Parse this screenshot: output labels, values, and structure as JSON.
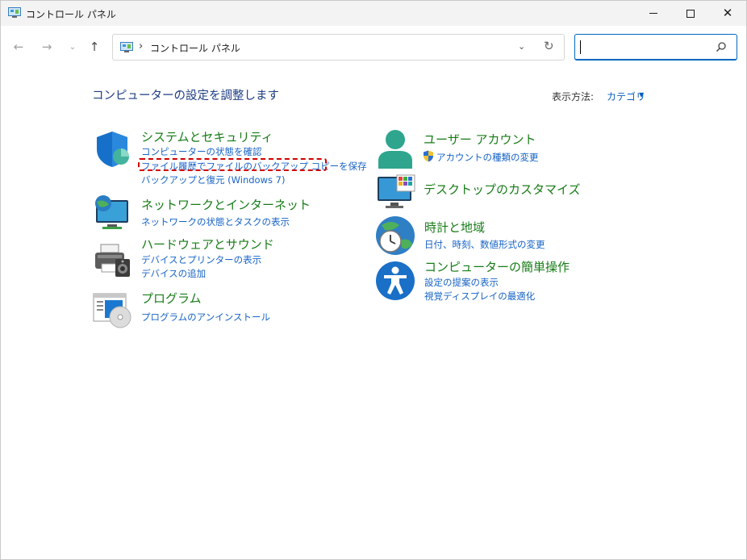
{
  "window": {
    "title": "コントロール パネル"
  },
  "nav": {
    "back_glyph": "←",
    "forward_glyph": "→",
    "recent_glyph": "⌄",
    "up_glyph": "↑"
  },
  "address_bar": {
    "separator": "›",
    "path": "コントロール パネル",
    "dropdown_glyph": "⌄",
    "refresh_glyph": "↻"
  },
  "search": {
    "value": ""
  },
  "header": {
    "title": "コンピューターの設定を調整します",
    "view_by_label": "表示方法:",
    "view_by_value": "カテゴリ",
    "view_by_arrow": "▼"
  },
  "categories": [
    {
      "title": "システムとセキュリティ",
      "links": [
        "コンピューターの状態を確認",
        "ファイル履歴でファイルのバックアップ コピーを保存",
        "バックアップと復元 (Windows 7)"
      ]
    },
    {
      "title": "ネットワークとインターネット",
      "links": [
        "ネットワークの状態とタスクの表示"
      ]
    },
    {
      "title": "ハードウェアとサウンド",
      "links": [
        "デバイスとプリンターの表示",
        "デバイスの追加"
      ]
    },
    {
      "title": "プログラム",
      "links": [
        "プログラムのアンインストール"
      ]
    },
    {
      "title": "ユーザー アカウント",
      "links": [
        "アカウントの種類の変更"
      ]
    },
    {
      "title": "デスクトップのカスタマイズ",
      "links": []
    },
    {
      "title": "時計と地域",
      "links": [
        "日付、時刻、数値形式の変更"
      ]
    },
    {
      "title": "コンピューターの簡単操作",
      "links": [
        "設定の提案の表示",
        "視覚ディスプレイの最適化"
      ]
    }
  ],
  "colors": {
    "category_title": "#177c17",
    "link": "#1763c6",
    "highlight": "#d10000",
    "header": "#1e3d84"
  }
}
